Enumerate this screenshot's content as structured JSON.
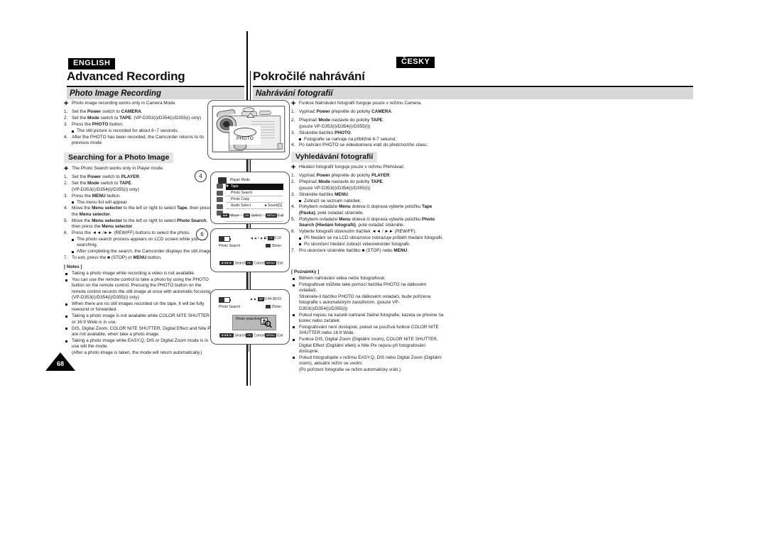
{
  "page": {
    "number": "68"
  },
  "left": {
    "lang_badge": "ENGLISH",
    "chapter_title": "Advanced Recording",
    "section_title": "Photo Image Recording",
    "intro_bullet": "Photo image recording works only in Camera Mode.",
    "steps": [
      {
        "num": "1.",
        "text": "Set the <b>Power</b> switch to <b>CAMERA</b>."
      },
      {
        "num": "2.",
        "text": "Set the <b>Mode</b> switch to <b>TAPE</b>. (VP-D353(i)/D354(i)/D355(i) only)"
      },
      {
        "num": "3.",
        "text": "Press the <b>PHOTO</b> button."
      },
      {
        "num": "sub",
        "text": "The still picture is recorded for about 6~7 seconds."
      },
      {
        "num": "4.",
        "text": "After the PHOTO has been recorded, the Camcorder returns to its previous mode."
      }
    ],
    "subsection_title": "Searching for a Photo Image",
    "search_bullet": "The Photo Search works only in Player mode.",
    "search_steps": [
      {
        "num": "1.",
        "text": "Set the <b>Power</b> switch to <b>PLAYER</b>."
      },
      {
        "num": "2.",
        "text": "Set the <b>Mode</b> switch to <b>TAPE</b>."
      },
      {
        "num": "cont",
        "text": "(VP-D353(i)/D354(i)/D355(i) only)"
      },
      {
        "num": "3.",
        "text": "Press the <b>MENU</b> button."
      },
      {
        "num": "sub",
        "text": "The menu list will appear."
      },
      {
        "num": "4.",
        "text": "Move the <b>Menu selector</b> to the left or right to select <b>Tape</b>, then press the <b>Menu selector</b>."
      },
      {
        "num": "5.",
        "text": "Move the <b>Menu selector</b> to the left or right to select <b>Photo Search</b>, then press the <b>Menu selector</b>."
      },
      {
        "num": "6.",
        "text": "Press the ◄◄ /►► (REW/FF) buttons to select the photo."
      },
      {
        "num": "sub",
        "text": "The photo search process appears on LCD screen while you are searching."
      },
      {
        "num": "sub",
        "text": "After completing the search, the Camcorder displays the still image."
      },
      {
        "num": "7.",
        "text": "To exit, press the ■ (STOP) or <b>MENU</b> button."
      }
    ],
    "notes_heading": "[ Notes ]",
    "notes": [
      "Taking a photo image while recording a video is not available.",
      "You can use the remote control to take a photo by using the PHOTO button on the remote control. Pressing the PHOTO button on the remote control records the still image at once with automatic focusing. (VP-D353(i)/D354(i)/D355(i) only)",
      "When there are no still images recorded on the tape, it will be fully rewound or forwarded.",
      "Taking a photo image is not available while COLOR NITE SHUTTER or 16:9 Wide is in use.",
      "DIS, Digital Zoom, COLOR NITE SHUTTER, Digital Effect and Nite Pix are not available, when take a photo image.",
      "Taking a photo image while EASY.Q, DIS or Digital Zoom mode is in use will the mode.<br>(After a photo image is taken, the mode will return automatically.)"
    ]
  },
  "right": {
    "lang_badge": "ČESKY",
    "chapter_title": "Pokročilé nahrávání",
    "section_title": "Nahrávání fotografií",
    "intro_bullet": "Funkce Nahrávání fotografií funguje pouze v režimu Camera.",
    "steps": [
      {
        "num": "1.",
        "text": "Vypínač <b>Power</b> přepněte do polohy <b>CAMERA</b>."
      },
      {
        "num": "gap",
        "text": ""
      },
      {
        "num": "2.",
        "text": "Přepínač <b>Mode</b> nastavte do polohy <b>TAPE</b>."
      },
      {
        "num": "cont",
        "text": "(pouze VP-D353(i)/D354(i)/D355(i))"
      },
      {
        "num": "3.",
        "text": "Stiskněte tlačítko <b>PHOTO</b>."
      },
      {
        "num": "sub",
        "text": "Fotografie se nahraje na přibližně 6-7 sekund."
      },
      {
        "num": "4.",
        "text": "Po nahrání PHOTO se videokamera vrátí do předchozího stavu."
      }
    ],
    "subsection_title": "Vyhledávání fotografií",
    "search_bullet": "Hledání fotografií funguje pouze v režimu Přehrávač.",
    "search_steps": [
      {
        "num": "1.",
        "text": "Vypínač <b>Power</b> přepněte do polohy <b>PLAYER</b>."
      },
      {
        "num": "2.",
        "text": "Přepínač <b>Mode</b> nastavte do polohy <b>TAPE</b>."
      },
      {
        "num": "cont",
        "text": "(pouze VP-D353(i)/D354(i)/D355(i))"
      },
      {
        "num": "3.",
        "text": "Stiskněte tlačítko <b>MENU</b>."
      },
      {
        "num": "sub",
        "text": "Zobrazí se seznam nabídek."
      },
      {
        "num": "4.",
        "text": "Pohybem ovladače <b>Menu</b> doleva či doprava vyberte položku <b>Tape (Páska)</b>, poté ovladač stiskněte."
      },
      {
        "num": "5.",
        "text": "Pohybem ovladače <b>Menu</b> doleva či doprava vyberte položku <b>Photo Search (Hledání fotografií)</b>, poté ovladač stiskněte."
      },
      {
        "num": "6.",
        "text": "Vyberte fotografii stisknutím tlačítek ◄◄ / ►► (REW/FF)."
      },
      {
        "num": "sub",
        "text": "Při hledání se na LCD obrazovce zobrazuje průběh hledání fotografií."
      },
      {
        "num": "sub",
        "text": "Po skončení hledání zobrazí videorekordér fotografii."
      },
      {
        "num": "7.",
        "text": "Pro ukončení stiskněte tlačítko ■ (STOP) nebo <b>MENU</b>."
      }
    ],
    "notes_heading": "[ Poznámky ]",
    "notes": [
      "Během nahrávání videa nelze fotografovat.",
      "Fotografovat můžete také pomocí tlačítka PHOTO na dálkovém ovladači.<br>Stisknete-li tlačítko PHOTO na dálkovém ovladači, bude pořízena fotografie s automatickým zaostřením. (pouze VP-D353(i)/D354(i)/D355(i))",
      "Pokud nejsou na kazetě nahrané žádné fotografie, kazeta se převine na konec nebo začátek.",
      "Fotografování není dostupné, pokud se používá funkce COLOR NITE SHUTTER nebo 16:9 Wide.",
      "Funkce DIS, Digital Zoom (Digitální zoom), COLOR NITE SHUTTER, Digital Effect (Digitální efekt) a Nite Pix nejsou při fotografování dostupné.",
      "Pokud fotografujete v režimu EASY.Q, DIS nebo Digital Zoom (Digitální zoom), aktuální režim se uvolní.<br>(Po pořízení fotografie se režim automaticky vrátí.)"
    ]
  },
  "figures": {
    "camcorder": {
      "photo_button_label": "PHOTO"
    },
    "step_markers": {
      "first": "4",
      "second": "6"
    },
    "menu_screen": {
      "title": "Player Mode",
      "rows": [
        {
          "label": "Tape",
          "selected": true,
          "value": ""
        },
        {
          "label": "Photo Search",
          "selected": false,
          "value": ""
        },
        {
          "label": "Photo Copy",
          "selected": false,
          "value": ""
        },
        {
          "label": "Audio Select",
          "selected": false,
          "value": "Sound[1]"
        },
        {
          "label": "",
          "selected": false,
          "value": ""
        },
        {
          "label": "",
          "selected": false,
          "value": ""
        }
      ],
      "footer": [
        {
          "key": "◄►",
          "label": "Move"
        },
        {
          "key": "OK",
          "label": "Select"
        },
        {
          "key": "MENU",
          "label": "Exit"
        }
      ]
    },
    "lcd_search": {
      "transport": "◄◄ I ►►",
      "speed_badge": "SP",
      "timecode": "0:41:56:10",
      "mode_label": "Photo Search",
      "tape_remaining": "35min",
      "buttons": [
        {
          "key": "◄◄►►",
          "label": "Search"
        },
        {
          "key": "OK",
          "label": "Cancel"
        },
        {
          "key": "MENU",
          "label": "Exit"
        }
      ]
    },
    "lcd_searching": {
      "transport": "►►",
      "speed_badge": "SP",
      "timecode": "0:44:38:03",
      "mode_label": "Photo Search",
      "tape_remaining": "25min",
      "status_text": "Photo searching...",
      "buttons": [
        {
          "key": "◄◄►►",
          "label": "Search"
        },
        {
          "key": "OK",
          "label": "Cancel"
        },
        {
          "key": "MENU",
          "label": "Exit"
        }
      ]
    }
  }
}
